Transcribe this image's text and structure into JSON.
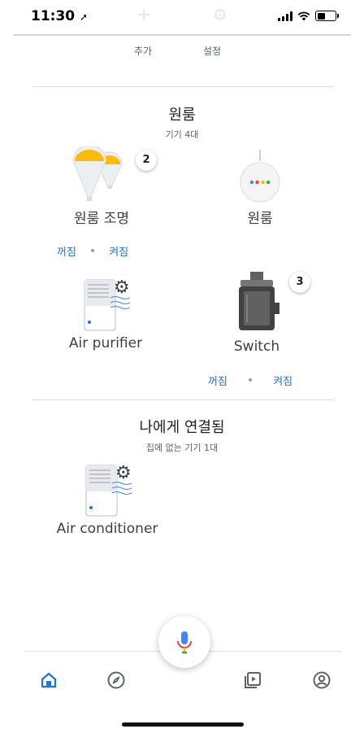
{
  "status_bar": {
    "time": "11:30"
  },
  "top_actions": {
    "add_label": "추가",
    "settings_label": "설정"
  },
  "room": {
    "title": "원룸",
    "subtitle": "기기 4대",
    "devices": [
      {
        "name": "원룸 조명",
        "badge": "2",
        "off_label": "꺼짐",
        "on_label": "켜짐"
      },
      {
        "name": "원룸"
      },
      {
        "name": "Air purifier"
      },
      {
        "name": "Switch",
        "badge": "3",
        "off_label": "꺼짐",
        "on_label": "켜짐"
      }
    ]
  },
  "linked": {
    "title": "나에게 연결됨",
    "subtitle": "집에 없는 기기 1대",
    "devices": [
      {
        "name": "Air conditioner"
      }
    ]
  },
  "nav": {
    "items": [
      {
        "icon": "home-icon",
        "active": true
      },
      {
        "icon": "compass-icon",
        "active": false
      },
      {
        "icon": "media-icon",
        "active": false
      },
      {
        "icon": "account-icon",
        "active": false
      }
    ]
  },
  "colors": {
    "accent": "#1a73e8",
    "bulb": "#fbbc04",
    "text": "#202124",
    "secondary": "#5f6368"
  }
}
